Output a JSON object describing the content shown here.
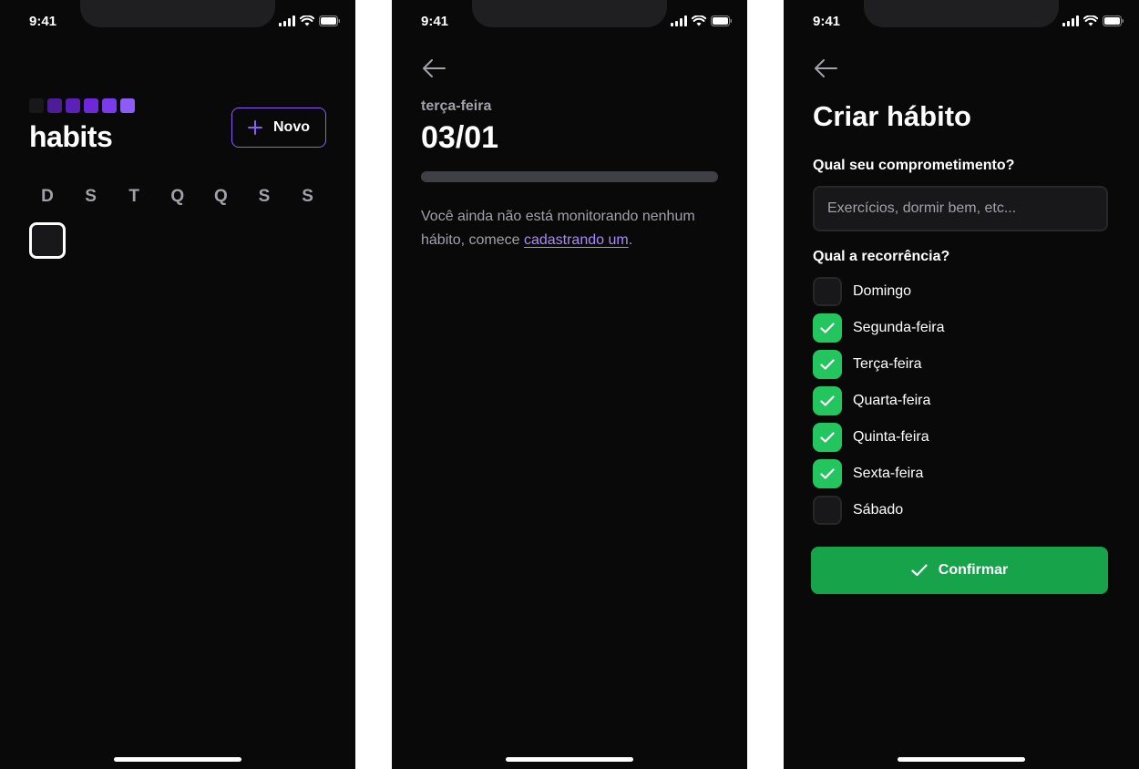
{
  "status_bar": {
    "time": "9:41"
  },
  "colors": {
    "background": "#09090a",
    "accent_violet": "#8b5cf6",
    "link": "#a78bfa",
    "success": "#22c55e",
    "confirm": "#16a34a"
  },
  "home": {
    "logo_text": "habits",
    "logo_square_colors": [
      "#18181b",
      "#4c1d95",
      "#5b21b6",
      "#6d28d9",
      "#7c3aed",
      "#8b5cf6"
    ],
    "new_button_label": "Novo",
    "week_days": [
      "D",
      "S",
      "T",
      "Q",
      "Q",
      "S",
      "S"
    ]
  },
  "habit_day": {
    "weekday": "terça-feira",
    "date": "03/01",
    "progress": 0,
    "empty_text": "Você ainda não está monitorando nenhum hábito, comece ",
    "empty_link": "cadastrando um",
    "empty_suffix": "."
  },
  "new_habit": {
    "title": "Criar hábito",
    "commitment_label": "Qual seu comprometimento?",
    "commitment_placeholder": "Exercícios, dormir bem, etc...",
    "recurrence_label": "Qual a recorrência?",
    "days": [
      {
        "label": "Domingo",
        "checked": false
      },
      {
        "label": "Segunda-feira",
        "checked": true
      },
      {
        "label": "Terça-feira",
        "checked": true
      },
      {
        "label": "Quarta-feira",
        "checked": true
      },
      {
        "label": "Quinta-feira",
        "checked": true
      },
      {
        "label": "Sexta-feira",
        "checked": true
      },
      {
        "label": "Sábado",
        "checked": false
      }
    ],
    "confirm_label": "Confirmar"
  }
}
